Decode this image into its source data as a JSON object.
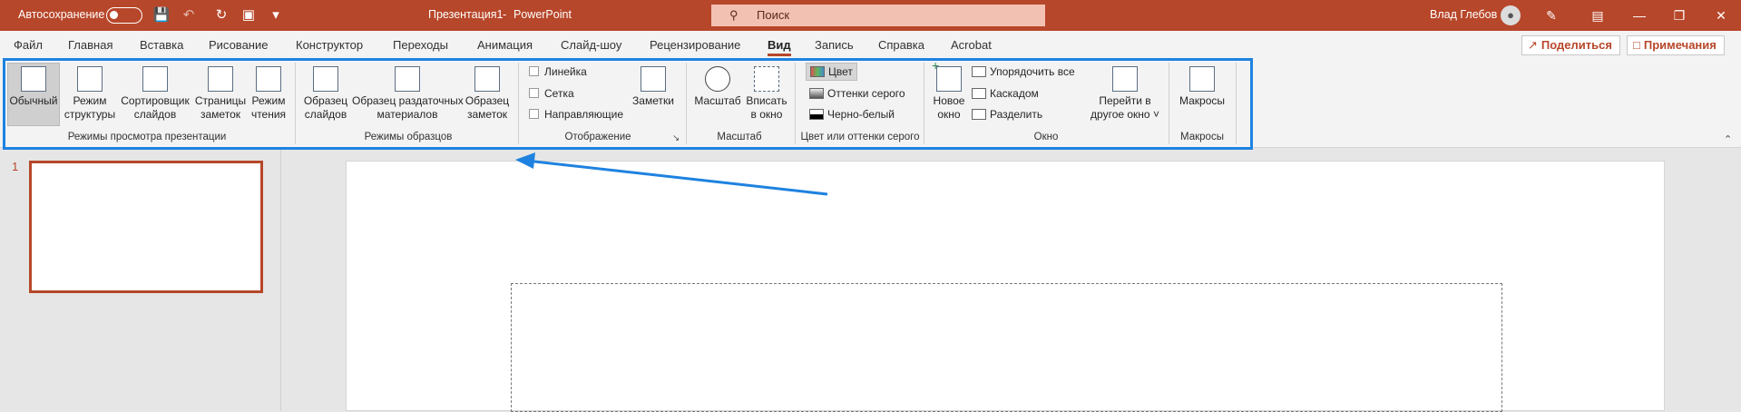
{
  "titlebar": {
    "autosave_label": "Автосохранение",
    "doc_title": "Презентация1",
    "separator": "-",
    "app_name": "PowerPoint",
    "search_placeholder": "Поиск",
    "user_name": "Влад Глебов"
  },
  "menu": {
    "tabs": [
      "Файл",
      "Главная",
      "Вставка",
      "Рисование",
      "Конструктор",
      "Переходы",
      "Анимация",
      "Слайд-шоу",
      "Рецензирование",
      "Вид",
      "Запись",
      "Справка",
      "Acrobat"
    ],
    "active_tab": "Вид",
    "share_label": "Поделиться",
    "comments_label": "Примечания"
  },
  "ribbon": {
    "views": {
      "group_label": "Режимы просмотра презентации",
      "normal": "Обычный",
      "outline_1": "Режим",
      "outline_2": "структуры",
      "sorter_1": "Сортировщик",
      "sorter_2": "слайдов",
      "notes_1": "Страницы",
      "notes_2": "заметок",
      "reading_1": "Режим",
      "reading_2": "чтения"
    },
    "masters": {
      "group_label": "Режимы образцов",
      "slide_1": "Образец",
      "slide_2": "слайдов",
      "handout_1": "Образец раздаточных",
      "handout_2": "материалов",
      "notes_1": "Образец",
      "notes_2": "заметок"
    },
    "show": {
      "group_label": "Отображение",
      "ruler": "Линейка",
      "grid": "Сетка",
      "guides": "Направляющие",
      "notes": "Заметки"
    },
    "zoom": {
      "group_label": "Масштаб",
      "zoom": "Масштаб",
      "fit_1": "Вписать",
      "fit_2": "в окно"
    },
    "color": {
      "group_label": "Цвет или оттенки серого",
      "color": "Цвет",
      "grayscale": "Оттенки серого",
      "bw": "Черно-белый"
    },
    "window": {
      "group_label": "Окно",
      "new_1": "Новое",
      "new_2": "окно",
      "arrange": "Упорядочить все",
      "cascade": "Каскадом",
      "split": "Разделить",
      "switch_1": "Перейти в",
      "switch_2": "другое окно ˅"
    },
    "macros": {
      "group_label": "Макросы",
      "macros": "Макросы"
    }
  },
  "slides": {
    "number": "1"
  },
  "colors": {
    "accent": "#b7472a",
    "highlight": "#1f82e0"
  }
}
